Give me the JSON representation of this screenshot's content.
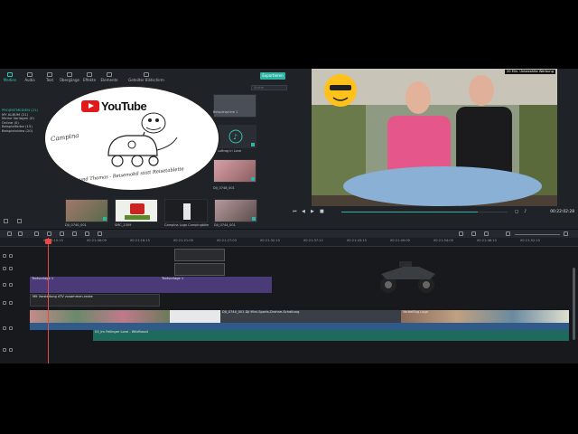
{
  "media": {
    "tabs": [
      {
        "label": "Medien",
        "active": true
      },
      {
        "label": "Audio"
      },
      {
        "label": "Text"
      },
      {
        "label": "Übergänge"
      },
      {
        "label": "Effekte"
      },
      {
        "label": "Elemente"
      },
      {
        "label": "Geteilter Bildschirm"
      }
    ],
    "export_label": "Exportieren",
    "search_placeholder": "Suche",
    "tree": [
      {
        "label": "PROJEKTMEDIEN (21)",
        "selected": true
      },
      {
        "label": "MY ALBUM (21)"
      },
      {
        "label": "Meine Vorlagen (0)"
      },
      {
        "label": "Online (0)"
      },
      {
        "label": "Beispielfarbe (15)"
      },
      {
        "label": "Beispielvideo (20)"
      }
    ],
    "import_label": "Importieren",
    "thumbnails": [
      {
        "label": "Beispielgrüne 1"
      },
      {
        "label": "In Auftrag in Lone"
      },
      {
        "label": "DJI_0737"
      },
      {
        "label": "DJI_0748_001"
      },
      {
        "label": "DJI_0740_001"
      },
      {
        "label": "SMC_2309"
      },
      {
        "label": "Campina Logo Campingbike"
      },
      {
        "label": "DJI_0744_001"
      }
    ]
  },
  "logo": {
    "brand": "YouTube",
    "camp": "Campina",
    "tagline": "Bine und Thomas - Reisemobil statt Reisetablette"
  },
  "preview": {
    "badge": "20 Min. Unbezahlte Werbung",
    "time": "00:22:02:28",
    "progress_fraction": 0.82
  },
  "timeline": {
    "ticks": [
      "00:00:10:15",
      "00:21:06:09",
      "00:21:16:15",
      "00:21:21:00",
      "00:21:27:03",
      "00:21:32:10",
      "00:21:37:12",
      "00:21:43:15",
      "00:21:49:00",
      "00:21:54:05",
      "00:21:48:10",
      "00:21:52:10"
    ],
    "clips": {
      "text1": "Textvorlage 1",
      "text2": "Textvorlage 1",
      "subtitle": "Mit Vorstellung ATV zusammen-recke",
      "video_mid": "DJI_0744_001 Dji Mini-Sports-Drohne-Schaltung",
      "video_end": "Vorbeiflug Logo",
      "audio": "03_Im Feilinger Lone - Wildfluss4"
    }
  }
}
